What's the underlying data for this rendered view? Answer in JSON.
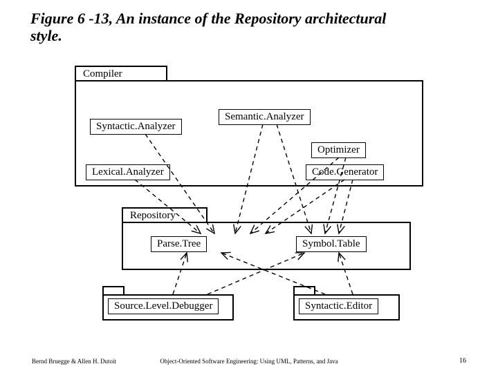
{
  "title": "Figure 6 -13, An instance of the Repository architectural style.",
  "packages": {
    "compiler": "Compiler",
    "repository": "Repository"
  },
  "boxes": {
    "syntacticAnalyzer": "Syntactic.Analyzer",
    "semanticAnalyzer": "Semantic.Analyzer",
    "optimizer": "Optimizer",
    "lexicalAnalyzer": "Lexical.Analyzer",
    "codeGenerator": "Code.Generator",
    "parseTree": "Parse.Tree",
    "symbolTable": "Symbol.Table",
    "sourceLevelDebugger": "Source.Level.Debugger",
    "syntacticEditor": "Syntactic.Editor"
  },
  "footer": {
    "left": "Bernd Bruegge & Allen H. Dutoit",
    "center": "Object-Oriented Software Engineering: Using UML, Patterns, and Java",
    "pageNumber": "16"
  }
}
